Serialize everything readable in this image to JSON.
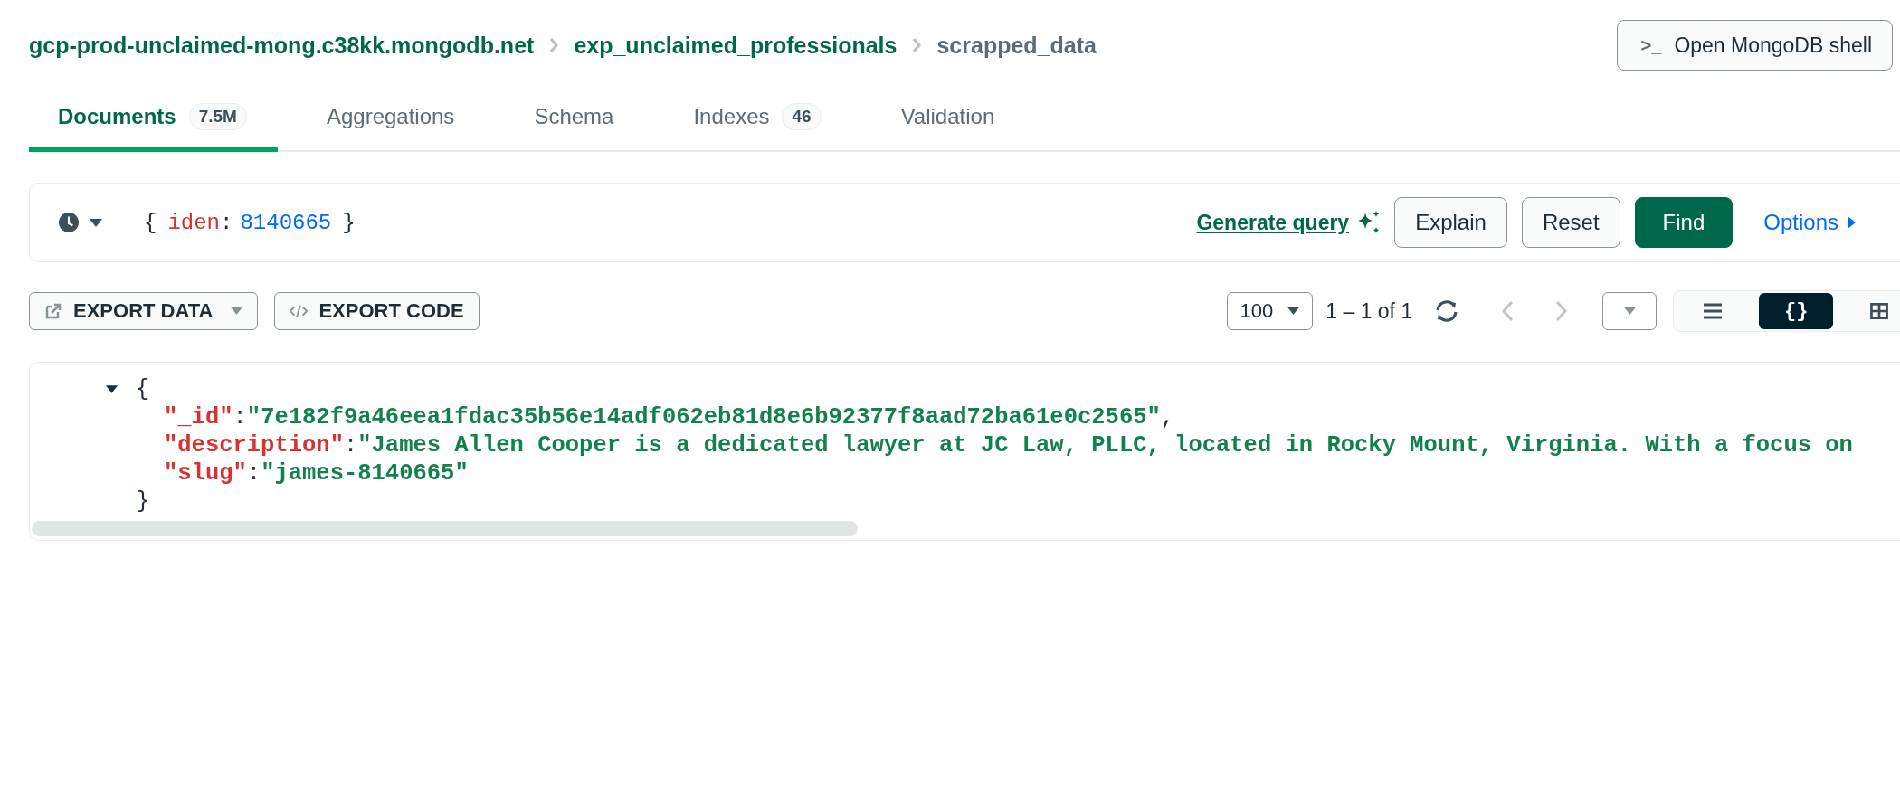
{
  "breadcrumb": [
    {
      "label": "gcp-prod-unclaimed-mong.c38kk.mongodb.net",
      "kind": "link"
    },
    {
      "label": "exp_unclaimed_professionals",
      "kind": "link"
    },
    {
      "label": "scrapped_data",
      "kind": "current"
    }
  ],
  "shell_button": {
    "icon": ">_",
    "label": "Open MongoDB shell"
  },
  "tabs": [
    {
      "label": "Documents",
      "badge": "7.5M",
      "selected": true
    },
    {
      "label": "Aggregations",
      "selected": false
    },
    {
      "label": "Schema",
      "selected": false
    },
    {
      "label": "Indexes",
      "badge": "46",
      "selected": false
    },
    {
      "label": "Validation",
      "selected": false
    }
  ],
  "query": {
    "tokens": [
      {
        "text": "{",
        "kind": "punct"
      },
      {
        "text": "iden",
        "kind": "key"
      },
      {
        "text": ":",
        "kind": "punct"
      },
      {
        "text": "8140665",
        "kind": "number"
      },
      {
        "text": "}",
        "kind": "punct"
      }
    ],
    "generate_label": "Generate query",
    "buttons": [
      {
        "label": "Explain",
        "kind": "outline"
      },
      {
        "label": "Reset",
        "kind": "outline"
      },
      {
        "label": "Find",
        "kind": "primary"
      }
    ],
    "options_label": "Options"
  },
  "toolbar": {
    "export_data": "EXPORT DATA",
    "export_code": "EXPORT CODE",
    "page_size": "100",
    "range": "1 – 1 of 1",
    "prev_disabled": true,
    "next_disabled": true,
    "views": [
      {
        "kind": "list",
        "selected": false
      },
      {
        "kind": "json",
        "label": "{}",
        "selected": true
      },
      {
        "kind": "table",
        "selected": false
      }
    ]
  },
  "document": {
    "expanded": true,
    "open": "{",
    "close": "}",
    "separator": ":",
    "fields": [
      {
        "key": "\"_id\"",
        "value": "\"7e182f9a46eea1fdac35b56e14adf062eb81d8e6b92377f8aad72ba61e0c2565\"",
        "trail": ","
      },
      {
        "key": "\"description\"",
        "value": "\"James Allen Cooper is a dedicated lawyer at JC Law, PLLC, located in Rocky Mount, Virginia. With a focus on"
      },
      {
        "key": "\"slug\"",
        "value": "\"james-8140665\""
      }
    ]
  }
}
